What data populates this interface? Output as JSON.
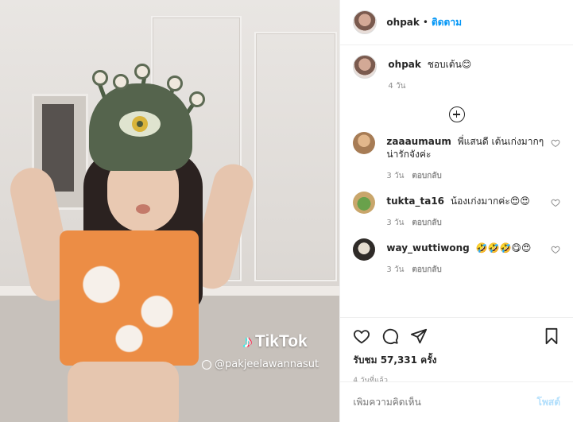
{
  "header": {
    "username": "ohpak",
    "separator": "•",
    "follow_label": "ติดตาม"
  },
  "caption": {
    "username": "ohpak",
    "text": "ชอบเต้น😊",
    "age": "4 วัน"
  },
  "comments": [
    {
      "username": "zaaaumaum",
      "text": "พี่แสนดี เต้นเก่งมากๆ น่ารักจังค่ะ",
      "age": "3 วัน",
      "reply": "ตอบกลับ"
    },
    {
      "username": "tukta_ta16",
      "text": "น้องเก่งมากค่ะ😍😍",
      "age": "3 วัน",
      "reply": "ตอบกลับ"
    },
    {
      "username": "way_wuttiwong",
      "text": "🤣🤣🤣😋😍",
      "age": "3 วัน",
      "reply": "ตอบกลับ"
    }
  ],
  "actions": {
    "likes_label": "รับชม 57,331 ครั้ง",
    "timestamp": "4 วันที่แล้ว",
    "icons": [
      "heart-icon",
      "comment-icon",
      "share-icon",
      "bookmark-icon"
    ]
  },
  "add_comment": {
    "placeholder": "เพิ่มความคิดเห็น",
    "post_label": "โพสต์"
  },
  "video": {
    "tiktok_logo": "TikTok",
    "tiktok_user": "@pakjeelawannasut"
  },
  "colors": {
    "link_blue": "#0095f6",
    "post_disabled": "#b2dffc",
    "muted": "#8e8e8e"
  }
}
